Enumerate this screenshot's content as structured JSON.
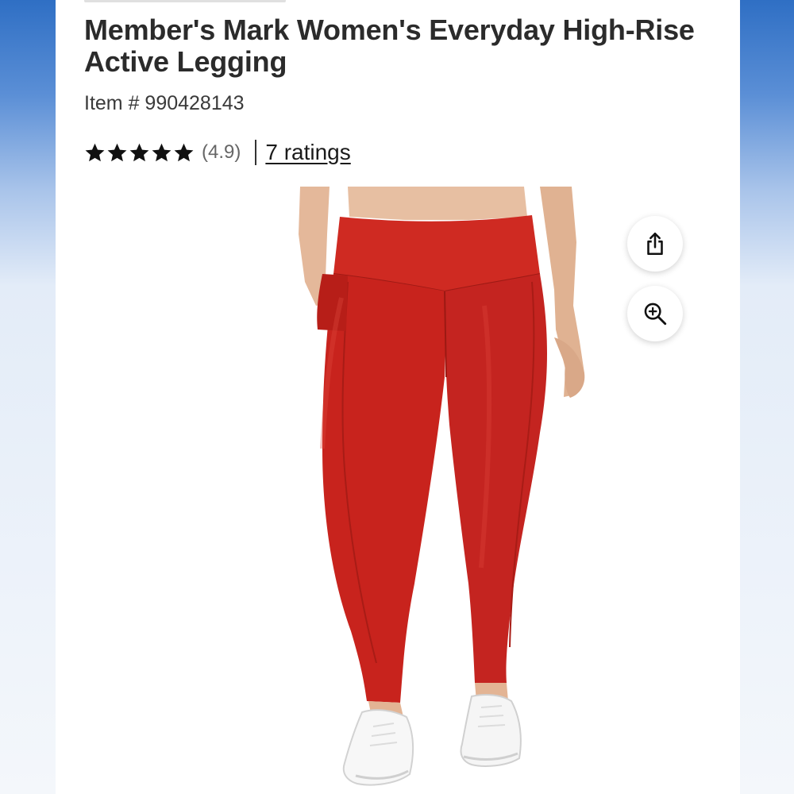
{
  "product": {
    "title": "Member's Mark Women's Everyday High-Rise Active Legging",
    "item_number": "Item # 990428143",
    "rating": {
      "stars": 5,
      "value_text": "(4.9)",
      "ratings_link": "7 ratings"
    },
    "image": {
      "subject": "red high-rise leggings with white sneakers"
    }
  },
  "actions": {
    "share_icon": "share-icon",
    "zoom_icon": "zoom-in-icon"
  },
  "colors": {
    "legging_red": "#c8231d",
    "text": "#2b2b2b",
    "background_blue": "#2f6fc4"
  }
}
